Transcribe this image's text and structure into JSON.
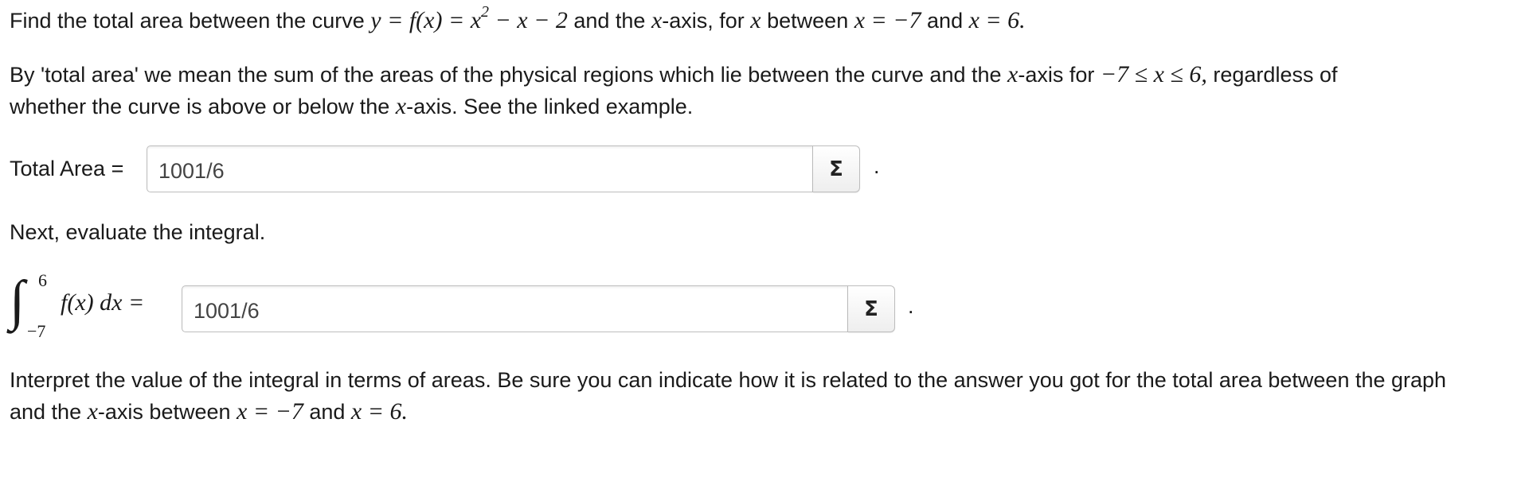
{
  "question": {
    "intro_text_1": "Find the total area between the curve ",
    "intro_math_1": "y = f(x) = x",
    "intro_math_sup": "2",
    "intro_math_2": " − x − 2",
    "intro_text_2": " and the ",
    "intro_math_3": "x",
    "intro_text_3": "-axis, for ",
    "intro_math_4": "x",
    "intro_text_4": " between ",
    "intro_math_5": "x = −7",
    "intro_text_5": " and ",
    "intro_math_6": "x = 6.",
    "def_text_1": "By 'total area' we mean the sum of the areas of the physical regions which lie between the curve and the ",
    "def_math_1": "x",
    "def_text_2": "-axis for ",
    "def_math_2": "−7 ≤ x ≤ 6,",
    "def_text_3": " regardless of",
    "def_text_4": "whether the curve is above or below the ",
    "def_math_3": "x",
    "def_text_5": "-axis. See the linked example."
  },
  "total_area": {
    "label": "Total Area =",
    "value": "1001/6",
    "sigma": "Σ",
    "trailing": "."
  },
  "next_step": {
    "text": "Next, evaluate the integral."
  },
  "integral": {
    "sign": "∫",
    "upper": "6",
    "lower": "−7",
    "body": "f(x) dx =",
    "value": "1001/6",
    "sigma": "Σ",
    "trailing": "."
  },
  "interpret": {
    "text_1": "Interpret the value of the integral in terms of areas. Be sure you can indicate how it is related to the answer you got for the total area between the graph",
    "text_2": "and the ",
    "math_1": "x",
    "text_3": "-axis between ",
    "math_2": "x = −7",
    "text_4": " and ",
    "math_3": "x = 6."
  }
}
